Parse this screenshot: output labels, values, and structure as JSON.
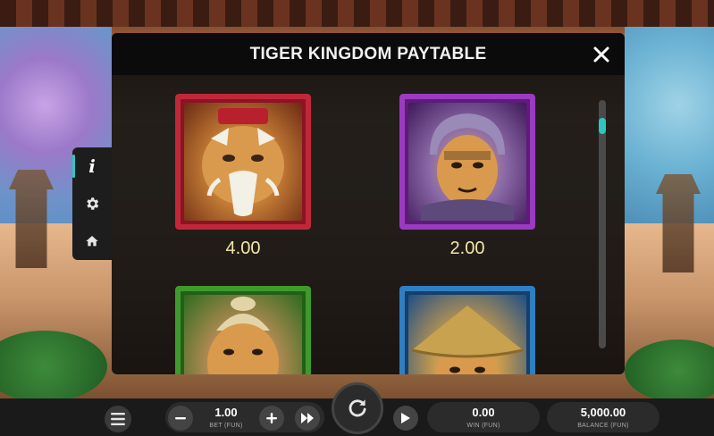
{
  "paytable": {
    "title": "TIGER KINGDOM PAYTABLE",
    "symbols": [
      {
        "name": "Elder Tiger",
        "frame_color": "#c0283a",
        "payout": "4.00"
      },
      {
        "name": "Warrior Tiger",
        "frame_color": "#9b3bc2",
        "payout": "2.00"
      },
      {
        "name": "Monk Tiger",
        "frame_color": "#3e9a2c",
        "payout": ""
      },
      {
        "name": "Straw Hat Tiger",
        "frame_color": "#2f7fc2",
        "payout": ""
      }
    ]
  },
  "side_menu": {
    "info_label": "i",
    "items": [
      "info-icon",
      "gear-icon",
      "home-icon"
    ]
  },
  "bottom_bar": {
    "bet_value": "1.00",
    "bet_label": "BET (FUN)",
    "win_value": "0.00",
    "win_label": "WIN (FUN)",
    "balance_value": "5,000.00",
    "balance_label": "BALANCE (FUN)"
  },
  "colors": {
    "accent": "#2ec7c0",
    "payout_text": "#f5e7a8",
    "panel_bg": "#0b0b0b"
  }
}
